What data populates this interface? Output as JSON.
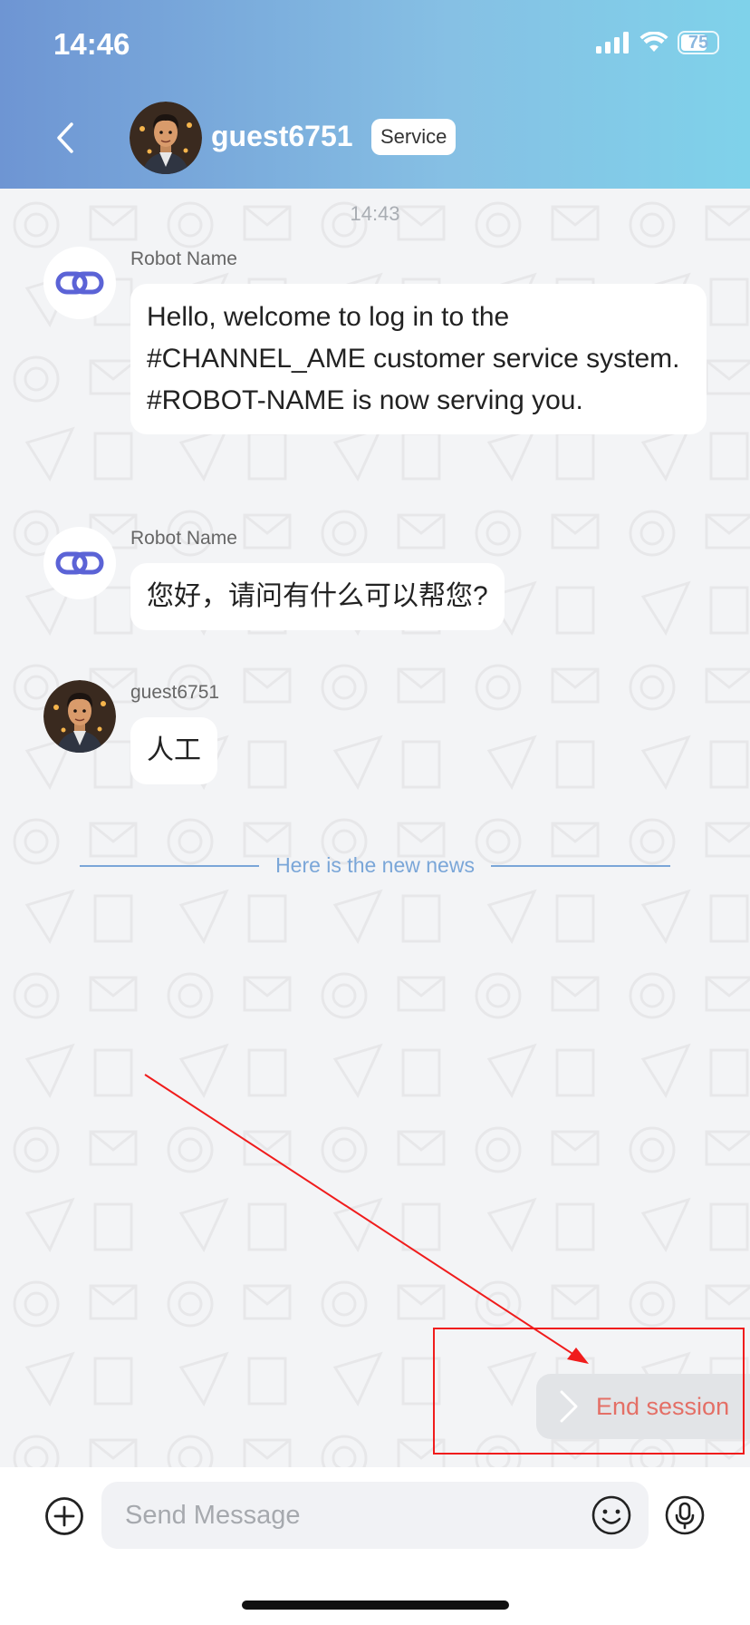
{
  "status_bar": {
    "time": "14:46",
    "battery": "75",
    "battery_level": 0.75
  },
  "header": {
    "title": "guest6751",
    "badge": "Service",
    "back_icon": "chevron-left-icon",
    "avatar_icon": "user-avatar"
  },
  "chat": {
    "timestamp": "14:43",
    "messages": [
      {
        "sender": "Robot Name",
        "text": "Hello, welcome to log in to the #CHANNEL_AME customer service system. #ROBOT-NAME is now serving you.",
        "avatar": "link-icon"
      },
      {
        "sender": "Robot Name",
        "text": "您好，请问有什么可以帮您?",
        "avatar": "link-icon"
      },
      {
        "sender": "guest6751",
        "text": "人工",
        "avatar": "user-avatar"
      }
    ],
    "divider_text": "Here is the new news"
  },
  "end_session": {
    "label": "End session",
    "icon": "chevron-right-icon"
  },
  "composer": {
    "placeholder": "Send Message",
    "plus_icon": "plus-circle-icon",
    "emoji_icon": "smile-icon",
    "mic_icon": "microphone-icon"
  },
  "colors": {
    "header_start": "#6e95d3",
    "header_end": "#7fd2ea",
    "divider": "#7aa6d8",
    "end_session_text": "#e46f66",
    "annotation": "#f01c1c",
    "robot_icon": "#5b63d6"
  }
}
